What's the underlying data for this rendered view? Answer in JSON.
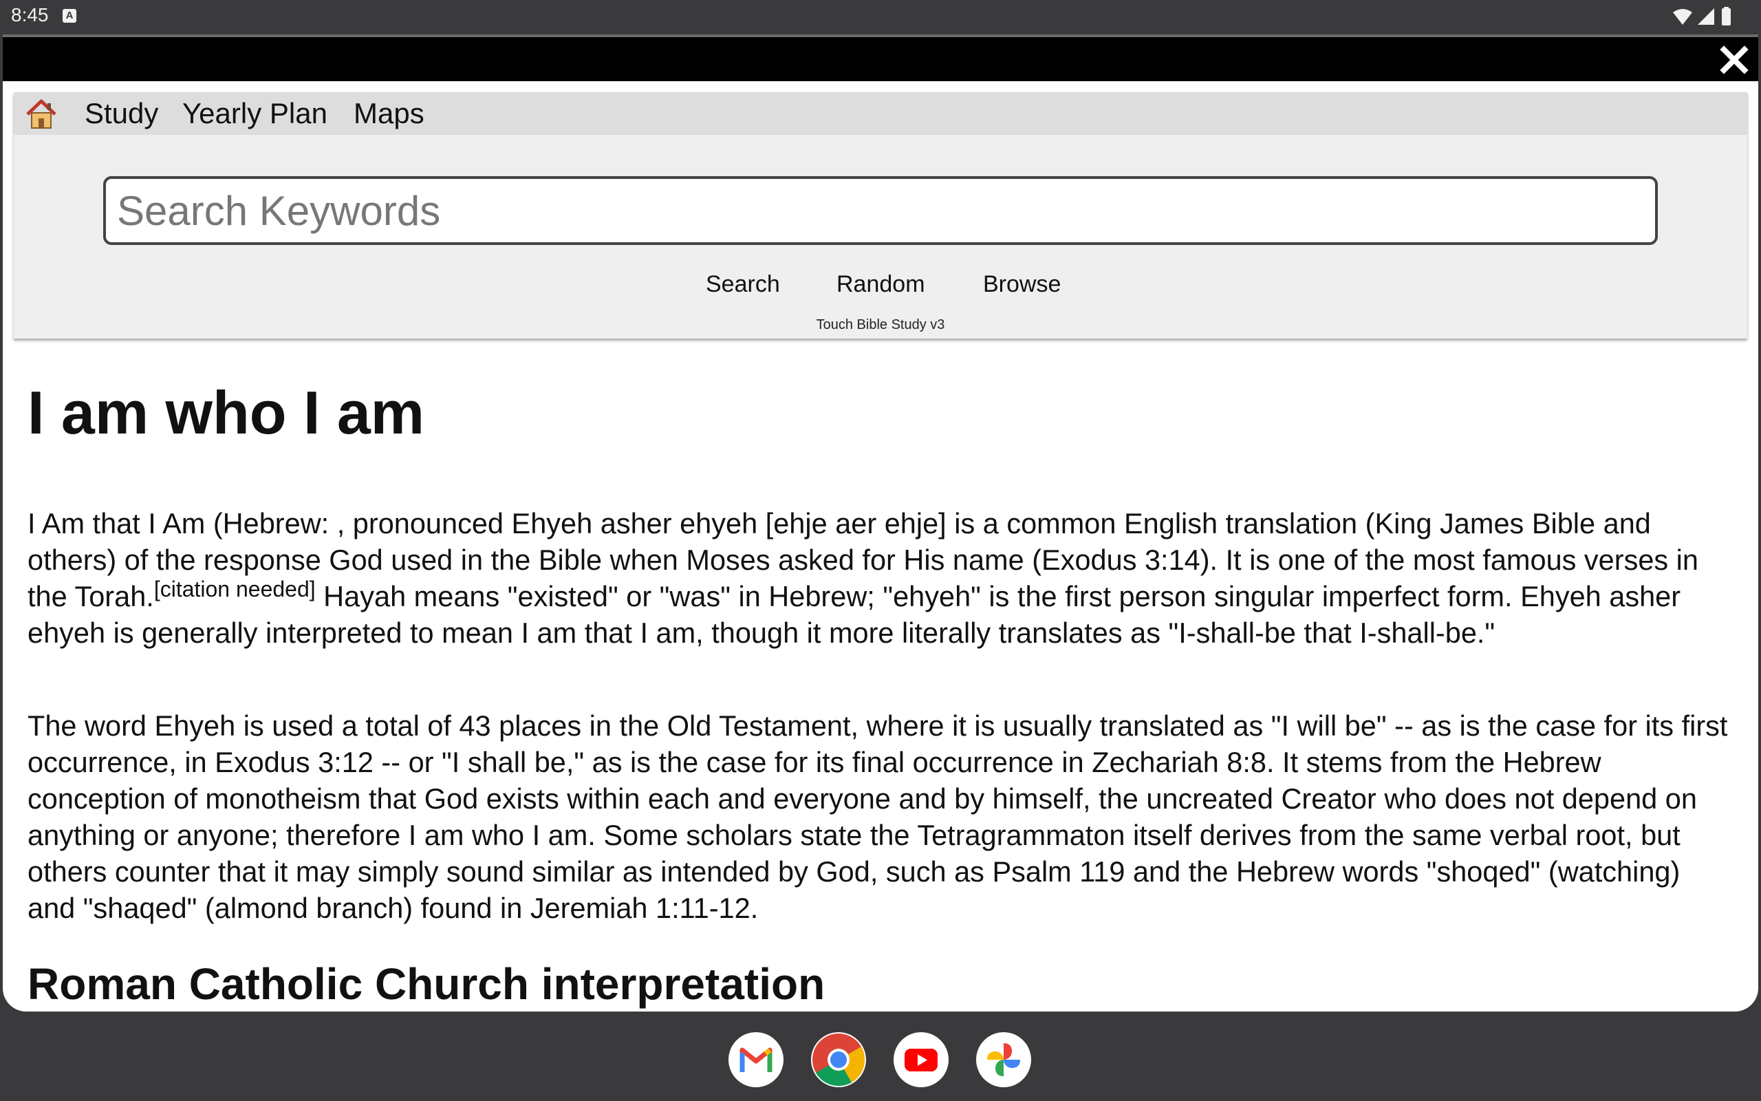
{
  "status_bar": {
    "time": "8:45",
    "notification_icon": "a-box-icon",
    "icons": [
      "wifi-icon",
      "cell-signal-icon",
      "battery-icon"
    ]
  },
  "window": {
    "close_icon": "close-icon"
  },
  "menu": {
    "home_icon": "home-icon",
    "items": [
      "Study",
      "Yearly Plan",
      "Maps"
    ]
  },
  "search": {
    "placeholder": "Search Keywords",
    "value": ""
  },
  "actions": [
    "Search",
    "Random",
    "Browse"
  ],
  "app_version": "Touch Bible Study v3",
  "article": {
    "title": "I am who I am",
    "p1_before_sup": "I Am that I Am (Hebrew: , pronounced Ehyeh asher ehyeh [ehje aer ehje] is a common English translation (King James Bible and others) of the response God used in the Bible when Moses asked for His name (Exodus 3:14). It is one of the most famous verses in the Torah.",
    "p1_sup": "[citation needed]",
    "p1_after_sup": " Hayah means \"existed\" or \"was\" in Hebrew; \"ehyeh\" is the first person singular imperfect form. Ehyeh asher ehyeh is generally interpreted to mean I am that I am, though it more literally translates as \"I-shall-be that I-shall-be.\"",
    "p2": "The word Ehyeh is used a total of 43 places in the Old Testament, where it is usually translated as \"I will be\" -- as is the case for its first occurrence, in Exodus 3:12 -- or \"I shall be,\" as is the case for its final occurrence in Zechariah 8:8. It stems from the Hebrew conception of monotheism that God exists within each and everyone and by himself, the uncreated Creator who does not depend on anything or anyone; therefore I am who I am. Some scholars state the Tetragrammaton itself derives from the same verbal root, but others counter that it may simply sound similar as intended by God, such as Psalm 119 and the Hebrew words \"shoqed\" (watching) and \"shaqed\" (almond branch) found in Jeremiah 1:11-12.",
    "section_heading": "Roman Catholic Church interpretation"
  },
  "taskbar": {
    "apps": [
      "gmail-icon",
      "chrome-icon",
      "youtube-icon",
      "photos-icon"
    ]
  },
  "colors": {
    "system_bar": "#3a3a3d",
    "title_bar": "#000000",
    "menu_bar": "#dddddd",
    "header_panel": "#efefef",
    "text": "#111111"
  }
}
